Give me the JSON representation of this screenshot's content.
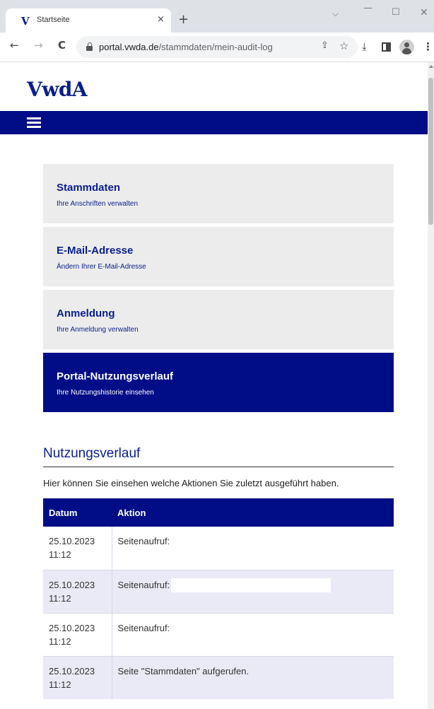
{
  "browser": {
    "tab": {
      "favicon": "V",
      "title": "Startseite",
      "close": "×"
    },
    "new_tab": "+",
    "window": {
      "chevron": "⌵",
      "minimize": "—",
      "maximize": "☐",
      "close": "✕"
    },
    "nav": {
      "back": "←",
      "forward": "→",
      "reload": "C"
    },
    "url": {
      "host": "portal.vwda.de",
      "path": "/stammdaten/mein-audit-log"
    },
    "icons": {
      "share": "⇪",
      "star": "☆",
      "download": "⤓",
      "menu": "⋮"
    }
  },
  "site": {
    "logo": "VwdA"
  },
  "menu_cards": [
    {
      "title": "Stammdaten",
      "subtitle": "Ihre Anschriften verwalten"
    },
    {
      "title": "E-Mail-Adresse",
      "subtitle": "Ändern Ihrer E-Mail-Adresse"
    },
    {
      "title": "Anmeldung",
      "subtitle": "Ihre Anmeldung verwalten"
    },
    {
      "title": "Portal-Nutzungsverlauf",
      "subtitle": "Ihre Nutzungshistorie einsehen"
    }
  ],
  "section": {
    "heading": "Nutzungsverlauf",
    "intro": "Hier können Sie einsehen welche Aktionen Sie zuletzt ausgeführt haben."
  },
  "table": {
    "headers": [
      "Datum",
      "Aktion"
    ],
    "rows": [
      {
        "date": "25.10.2023",
        "time": "11:12",
        "action": "Seitenaufruf:"
      },
      {
        "date": "25.10.2023",
        "time": "11:12",
        "action": "Seitenaufruf:"
      },
      {
        "date": "25.10.2023",
        "time": "11:12",
        "action": "Seitenaufruf:"
      },
      {
        "date": "25.10.2023",
        "time": "11:12",
        "action": "Seite \"Stammdaten\" aufgerufen."
      }
    ]
  },
  "colors": {
    "brand": "#000d87",
    "brand_text": "#0a1e8c",
    "card_bg": "#ececec",
    "row_alt": "#e9eaf5"
  }
}
